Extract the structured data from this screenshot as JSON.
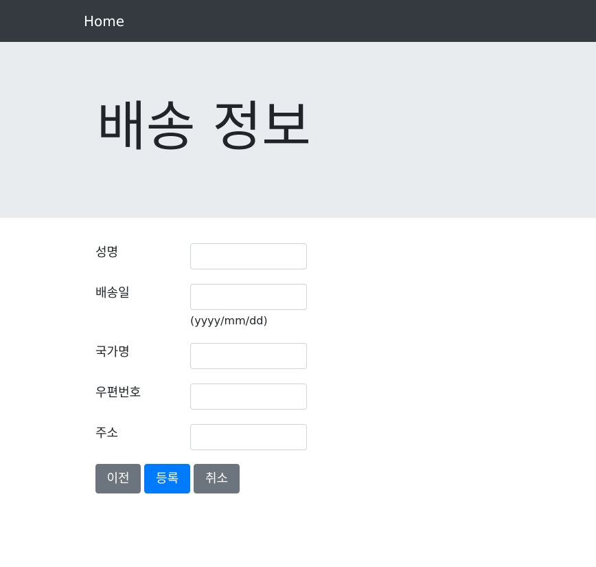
{
  "navbar": {
    "brand_label": "Home"
  },
  "jumbotron": {
    "title": "배송 정보"
  },
  "form": {
    "fields": [
      {
        "label": "성명",
        "value": ""
      },
      {
        "label": "배송일",
        "value": "",
        "hint": "(yyyy/mm/dd)"
      },
      {
        "label": "국가명",
        "value": ""
      },
      {
        "label": "우편번호",
        "value": ""
      },
      {
        "label": "주소",
        "value": ""
      }
    ]
  },
  "buttons": {
    "prev_label": "이전",
    "submit_label": "등록",
    "cancel_label": "취소"
  },
  "colors": {
    "navbar_bg": "#343a40",
    "jumbotron_bg": "#e9ecef",
    "primary": "#007bff",
    "secondary": "#6c757d"
  }
}
